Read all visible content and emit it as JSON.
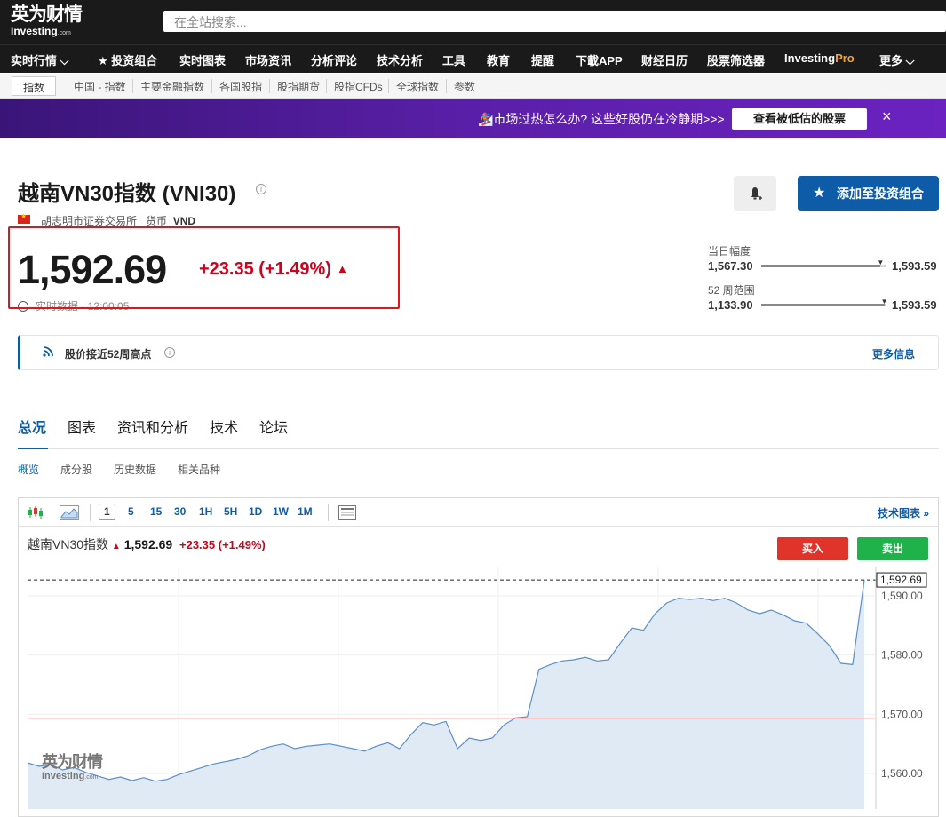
{
  "header": {
    "logo_cn": "英为财情",
    "logo_en": "Investing",
    "logo_domain": ".com",
    "search_placeholder": "在全站搜索..."
  },
  "nav": {
    "items": [
      "实时行情 ⌵",
      "★ 投资组合",
      "实时图表",
      "市场资讯",
      "分析评论",
      "技术分析",
      "工具",
      "教育",
      "提醒",
      "下載APP",
      "财经日历",
      "股票筛选器"
    ],
    "pro_prefix": "Investing",
    "pro_suffix": "Pro",
    "more": "更多 ⌵"
  },
  "subnav": {
    "active": "指数",
    "items": [
      "中国 - 指数",
      "主要金融指数",
      "各国股指",
      "股指期货",
      "股指CFDs",
      "全球指数",
      "参数"
    ]
  },
  "promo": {
    "text": "🏂市场过热怎么办? 这些好股仍在冷静期>>>",
    "button": "查看被低估的股票",
    "close": "×"
  },
  "instrument": {
    "title": "越南VN30指数 (VNI30)",
    "exchange": "胡志明市证券交易所",
    "currency_label": "货币",
    "currency": "VND",
    "price": "1,592.69",
    "change": "+23.35 (+1.49%)",
    "realtime": "实时数据 · 12:00:05"
  },
  "actions": {
    "add_portfolio": "添加至投资组合"
  },
  "ranges": {
    "day_label": "当日幅度",
    "day_low": "1,567.30",
    "day_high": "1,593.59",
    "day_position": 0.96,
    "week52_label": "52 周范围",
    "week52_low": "1,133.90",
    "week52_high": "1,593.59",
    "week52_position": 0.99
  },
  "alert": {
    "text": "股价接近52周高点",
    "more": "更多信息"
  },
  "tabs": [
    "总况",
    "图表",
    "资讯和分析",
    "技术",
    "论坛"
  ],
  "subtabs": [
    "概览",
    "成分股",
    "历史数据",
    "相关品种"
  ],
  "chart_toolbar": {
    "timeframes": [
      "1",
      "5",
      "15",
      "30",
      "1H",
      "5H",
      "1D",
      "1W",
      "1M"
    ],
    "selected": "1",
    "tech_link": "技术图表 »"
  },
  "chart_header": {
    "name": "越南VN30指数",
    "price": "1,592.69",
    "change": "+23.35 (+1.49%)",
    "buy": "买入",
    "sell": "卖出"
  },
  "colors": {
    "accent_blue": "#0e5ba8",
    "negative_red": "#d0021b",
    "buy_red": "#e0342a",
    "sell_green": "#1fb24a"
  },
  "chart_data": {
    "type": "area",
    "y_ticks": [
      "1,590.00",
      "1,580.00",
      "1,570.00",
      "1,560.00"
    ],
    "y_tick_values": [
      1590,
      1580,
      1570,
      1560
    ],
    "ylim": [
      1555.8,
      1594.8
    ],
    "last_label": "1,592.69",
    "last_value": 1592.69,
    "prev_close": 1569.34,
    "values": [
      1561.8,
      1561.2,
      1561.5,
      1560.6,
      1561.0,
      1560.2,
      1559.6,
      1559.0,
      1559.4,
      1558.8,
      1559.3,
      1558.7,
      1559.0,
      1559.8,
      1560.4,
      1561.0,
      1561.6,
      1562.0,
      1562.4,
      1563.0,
      1564.0,
      1564.6,
      1565.0,
      1564.2,
      1564.6,
      1564.8,
      1565.0,
      1564.6,
      1564.2,
      1563.8,
      1564.6,
      1565.2,
      1564.2,
      1566.6,
      1568.6,
      1568.2,
      1568.8,
      1564.2,
      1566.0,
      1565.6,
      1566.0,
      1568.2,
      1569.4,
      1569.6,
      1577.6,
      1578.4,
      1579.0,
      1579.2,
      1579.6,
      1579.0,
      1579.2,
      1582.0,
      1584.6,
      1584.2,
      1587.0,
      1588.8,
      1589.6,
      1589.4,
      1589.6,
      1589.2,
      1589.6,
      1588.8,
      1587.6,
      1587.0,
      1587.6,
      1586.8,
      1585.8,
      1585.4,
      1583.6,
      1581.6,
      1578.6,
      1578.4,
      1592.69
    ]
  }
}
